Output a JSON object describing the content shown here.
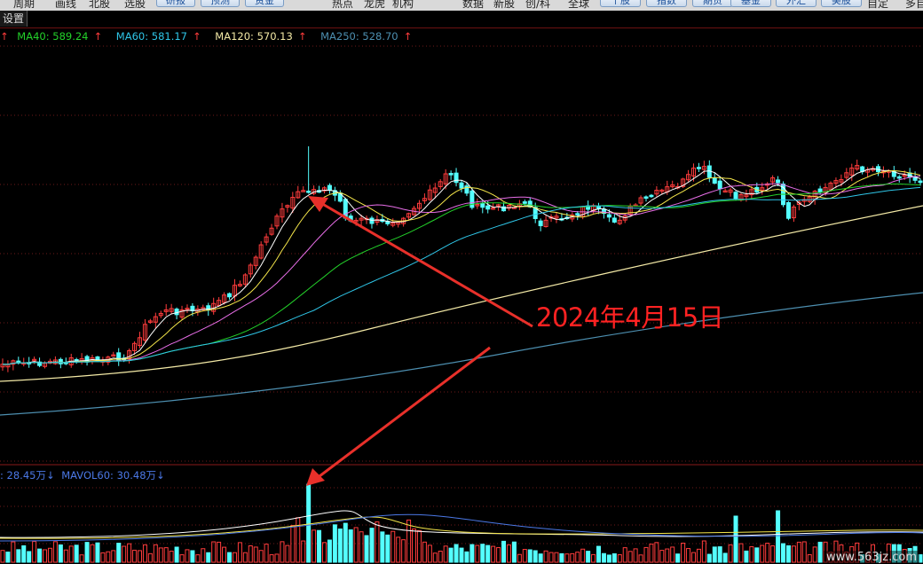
{
  "toolbar": {
    "items": [
      "周期",
      "画线",
      "北股",
      "选股",
      "热点",
      "龙虎",
      "机构",
      "数据",
      "新股",
      "创/科",
      "全球",
      "自定",
      "多自"
    ],
    "buttons": [
      "研报",
      "预测",
      "资金",
      "个股",
      "指数",
      "期货",
      "基金",
      "外汇",
      "美股"
    ]
  },
  "settings_label": "设置",
  "ma_legend": [
    {
      "label": "MA40: 589.24",
      "arrow": "↑",
      "color": "#23d12a"
    },
    {
      "label": "MA60: 581.17",
      "arrow": "↑",
      "color": "#2fc6e8"
    },
    {
      "label": "MA120: 570.13",
      "arrow": "↑",
      "color": "#f3e9a6"
    },
    {
      "label": "MA250: 528.70",
      "arrow": "↑",
      "color": "#4d8fb0"
    }
  ],
  "vol_legend": [
    {
      "label": ": 28.45万",
      "arrow": "↓",
      "color": "#4b78e6"
    },
    {
      "label": "MAVOL60: 30.48万",
      "arrow": "↓",
      "color": "#4b78e6"
    }
  ],
  "annotation": "2024年4月15日",
  "watermark": "www.563jz.com",
  "colors": {
    "up": "#ff3c3c",
    "down": "#54ffff",
    "arrow": "#e8302a",
    "grid": "#6e1a1a"
  }
}
